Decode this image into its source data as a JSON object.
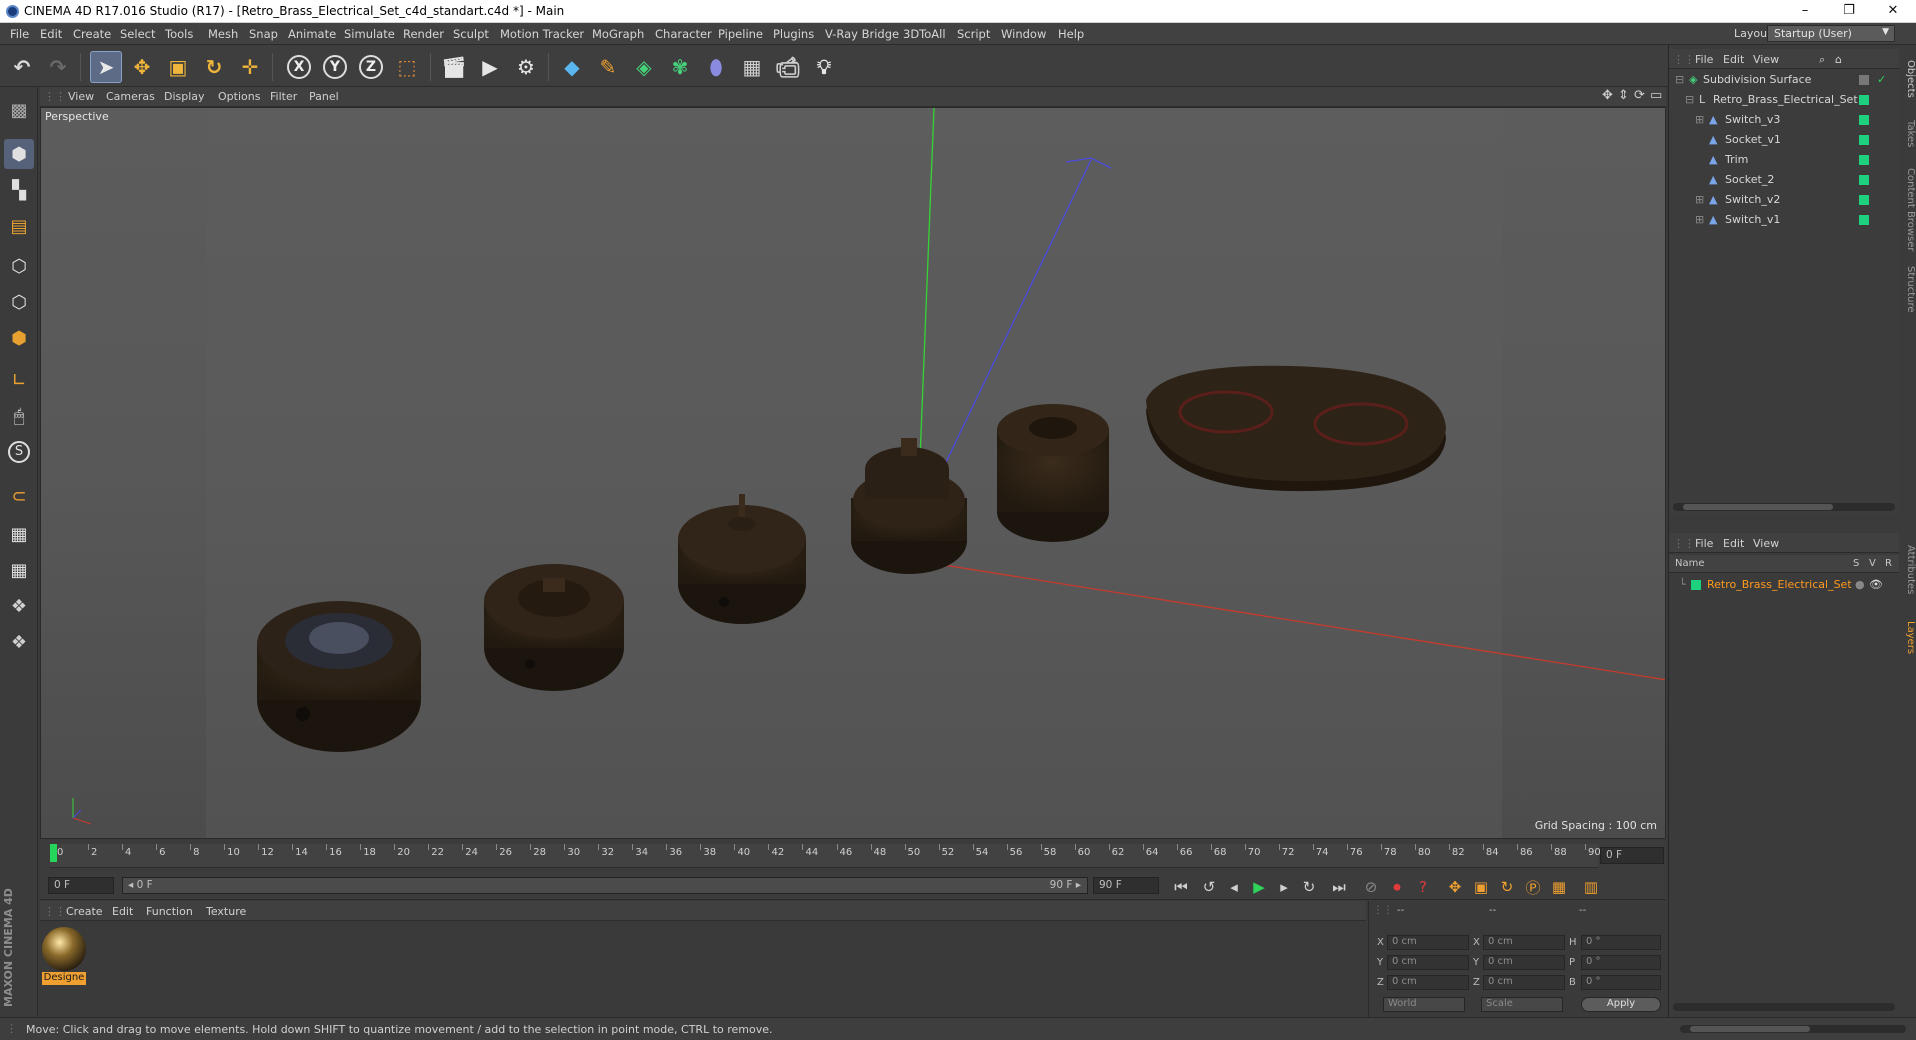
{
  "window": {
    "title": "CINEMA 4D R17.016 Studio (R17) - [Retro_Brass_Electrical_Set_c4d_standart.c4d *] - Main",
    "minimize": "–",
    "restore": "❐",
    "close": "✕"
  },
  "menu": [
    "File",
    "Edit",
    "Create",
    "Select",
    "Tools",
    "Mesh",
    "Snap",
    "Animate",
    "Simulate",
    "Render",
    "Sculpt",
    "Motion Tracker",
    "MoGraph",
    "Character",
    "Pipeline",
    "Plugins",
    "V-Ray Bridge",
    "3DToAll",
    "Script",
    "Window",
    "Help"
  ],
  "layout": {
    "label": "Layout:",
    "value": "Startup (User)"
  },
  "toolbar": {
    "x_axis": "X",
    "y_axis": "Y",
    "z_axis": "Z"
  },
  "viewport": {
    "menu": [
      "View",
      "Cameras",
      "Display",
      "Options",
      "Filter",
      "Panel"
    ],
    "label": "Perspective",
    "grid_spacing": "Grid Spacing : 100 cm"
  },
  "timeline": {
    "ticks": [
      "0",
      "2",
      "4",
      "6",
      "8",
      "10",
      "12",
      "14",
      "16",
      "18",
      "20",
      "22",
      "24",
      "26",
      "28",
      "30",
      "32",
      "34",
      "36",
      "38",
      "40",
      "42",
      "44",
      "46",
      "48",
      "50",
      "52",
      "54",
      "56",
      "58",
      "60",
      "62",
      "64",
      "66",
      "68",
      "70",
      "72",
      "74",
      "76",
      "78",
      "80",
      "82",
      "84",
      "86",
      "88",
      "90"
    ],
    "current_frame": "0 F",
    "start_field": "0 F",
    "range_start": "◂ 0 F",
    "range_end": "90 F ▸",
    "end_field": "90 F"
  },
  "material_manager": {
    "menu": [
      "Create",
      "Edit",
      "Function",
      "Texture"
    ],
    "material_name": "Designe"
  },
  "coordinates": {
    "header": [
      "--",
      "--",
      "--"
    ],
    "rows": [
      {
        "l1": "X",
        "v1": "0 cm",
        "l2": "X",
        "v2": "0 cm",
        "l3": "H",
        "v3": "0 °"
      },
      {
        "l1": "Y",
        "v1": "0 cm",
        "l2": "Y",
        "v2": "0 cm",
        "l3": "P",
        "v3": "0 °"
      },
      {
        "l1": "Z",
        "v1": "0 cm",
        "l2": "Z",
        "v2": "0 cm",
        "l3": "B",
        "v3": "0 °"
      }
    ],
    "mode_world": "World",
    "mode_scale": "Scale",
    "apply": "Apply"
  },
  "status": "Move: Click and drag to move elements. Hold down SHIFT to quantize movement / add to the selection in point mode, CTRL to remove.",
  "object_manager": {
    "menu": [
      "File",
      "Edit",
      "View"
    ],
    "objects": [
      {
        "name": "Subdivision Surface",
        "indent": 0
      },
      {
        "name": "Retro_Brass_Electrical_Set",
        "indent": 1
      },
      {
        "name": "Switch_v3",
        "indent": 2
      },
      {
        "name": "Socket_v1",
        "indent": 2
      },
      {
        "name": "Trim",
        "indent": 2
      },
      {
        "name": "Socket_2",
        "indent": 2
      },
      {
        "name": "Switch_v2",
        "indent": 2
      },
      {
        "name": "Switch_v1",
        "indent": 2
      }
    ]
  },
  "layer_manager": {
    "menu": [
      "File",
      "Edit",
      "View"
    ],
    "col_name": "Name",
    "col_s": "S",
    "col_v": "V",
    "col_r": "R",
    "layer": "Retro_Brass_Electrical_Set"
  },
  "side_tabs": [
    "Objects",
    "Takes",
    "Content Browser",
    "Structure",
    "Attributes",
    "Layers"
  ],
  "brand": "MAXON CINEMA 4D",
  "colors": {
    "accent_green": "#1ed17f",
    "layer_orange": "#ff9a1f",
    "axis_x": "#c0392b",
    "axis_y": "#2ecc40",
    "axis_z": "#4444cc"
  }
}
